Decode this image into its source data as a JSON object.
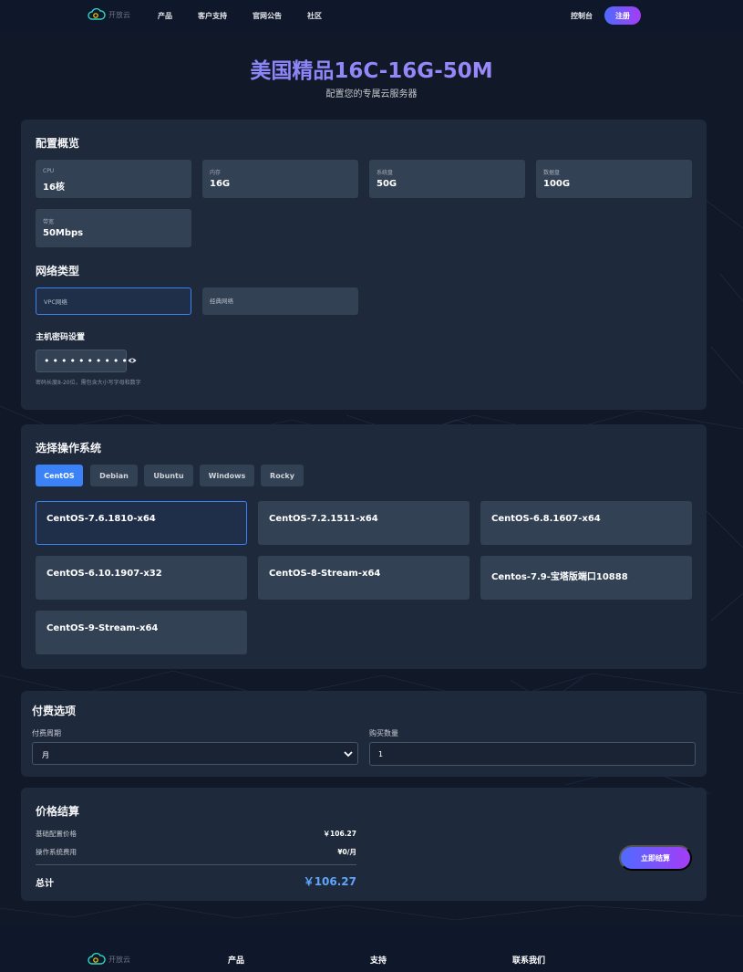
{
  "header": {
    "logo_text": "开放云",
    "nav": [
      "产品",
      "客户支持",
      "官网公告",
      "社区"
    ],
    "console": "控制台",
    "register": "注册"
  },
  "hero": {
    "title": "美国精品16C-16G-50M",
    "subtitle": "配置您的专属云服务器"
  },
  "config": {
    "title": "配置概览",
    "specs": [
      {
        "label": "CPU",
        "value": "16核"
      },
      {
        "label": "内存",
        "value": "16G"
      },
      {
        "label": "系统盘",
        "value": "50G"
      },
      {
        "label": "数据盘",
        "value": "100G"
      },
      {
        "label": "带宽",
        "value": "50Mbps"
      }
    ],
    "network_title": "网络类型",
    "network_options": [
      "VPC网络",
      "经典网络"
    ],
    "network_selected": "VPC网络",
    "password_title": "主机密码设置",
    "password_value": "••••••••••",
    "password_hint": "密码长度8-20位，需包含大小写字母和数字"
  },
  "os": {
    "title": "选择操作系统",
    "tabs": [
      "CentOS",
      "Debian",
      "Ubuntu",
      "Windows",
      "Rocky"
    ],
    "active_tab": "CentOS",
    "versions": [
      "CentOS-7.6.1810-x64",
      "CentOS-7.2.1511-x64",
      "CentOS-6.8.1607-x64",
      "CentOS-6.10.1907-x32",
      "CentOS-8-Stream-x64",
      "Centos-7.9-宝塔版端口10888",
      "CentOS-9-Stream-x64"
    ],
    "selected": "CentOS-7.6.1810-x64"
  },
  "billing": {
    "title": "付费选项",
    "period_label": "付费周期",
    "period_value": "月",
    "qty_label": "购买数量",
    "qty_value": "1"
  },
  "price": {
    "title": "价格结算",
    "base_label": "基础配置价格",
    "base_value": "￥106.27",
    "os_label": "操作系统费用",
    "os_value": "¥0/月",
    "total_label": "总计",
    "total_value": "￥106.27",
    "checkout": "立即结算"
  },
  "footer": {
    "logo_text": "开放云",
    "cols": [
      "产品",
      "支持",
      "联系我们"
    ]
  },
  "colors": {
    "accent": "#3b82f6",
    "background": "#111827",
    "card": "#1e293b",
    "title_gradient": "#8b7cf6"
  }
}
